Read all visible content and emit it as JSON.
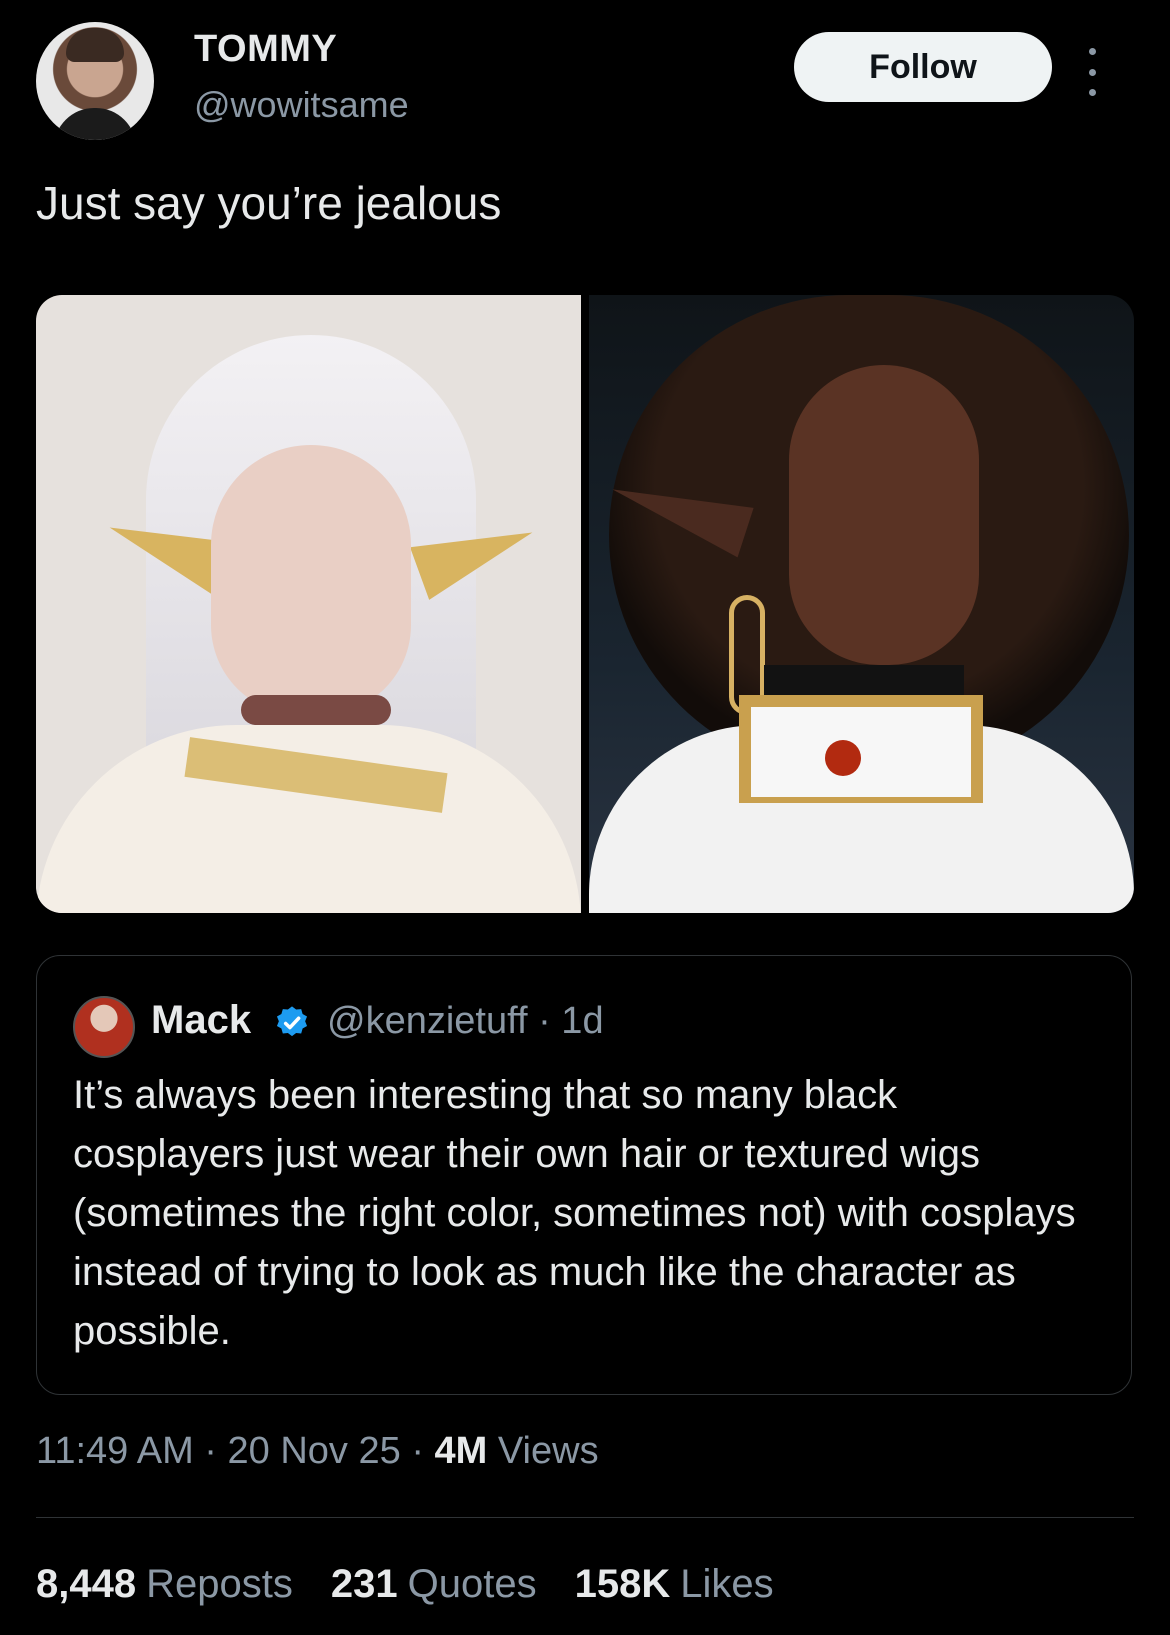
{
  "author": {
    "name": "TOMMY",
    "handle": "@wowitsame",
    "follow_label": "Follow"
  },
  "tweet": {
    "text": "Just say you’re jealous"
  },
  "quoted_tweet": {
    "name": "Mack",
    "handle_time": "@kenzietuff · 1d",
    "text": "It’s always been interesting that so many black cosplayers just wear their own hair or textured wigs (sometimes the right color, sometimes not) with cosplays instead of trying to look as much like the character as possible."
  },
  "meta": {
    "time": "11:49 AM",
    "date": "20 Nov 25",
    "views_count": "4M",
    "views_label": "Views"
  },
  "stats": {
    "reposts_count": "8,448",
    "reposts_label": "Reposts",
    "quotes_count": "231",
    "quotes_label": "Quotes",
    "likes_count": "158K",
    "likes_label": "Likes"
  },
  "colors": {
    "background": "#000000",
    "verified_badge": "#1d9bf0",
    "secondary_text": "#8b98a5"
  },
  "icons": [
    "more-options-icon",
    "verified-badge-icon"
  ]
}
